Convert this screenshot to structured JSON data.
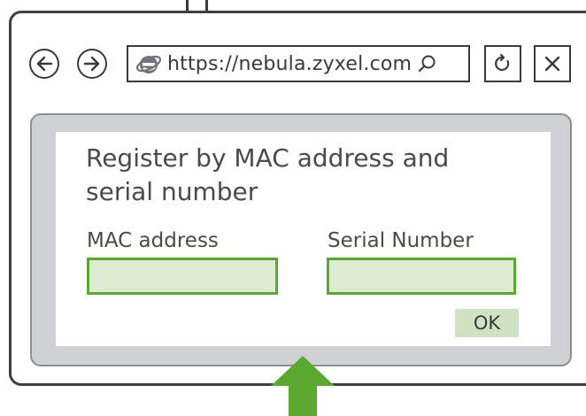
{
  "browser": {
    "url": "https://nebula.zyxel.com",
    "back_icon": "arrow-left-icon",
    "forward_icon": "arrow-right-icon",
    "site_icon": "internet-explorer-icon",
    "search_icon": "search-icon",
    "refresh_icon": "refresh-icon",
    "close_icon": "close-icon"
  },
  "form": {
    "title": "Register by MAC address and serial number",
    "mac_label": "MAC address",
    "mac_value": "",
    "serial_label": "Serial Number",
    "serial_value": "",
    "ok_label": "OK"
  },
  "indicator": {
    "icon": "arrow-up-icon",
    "color": "#5aa832"
  },
  "colors": {
    "field_fill": "#dcebd2",
    "field_border": "#5aa832",
    "button_fill": "#cfe2c2",
    "frame_fill": "#cfd1d3"
  }
}
